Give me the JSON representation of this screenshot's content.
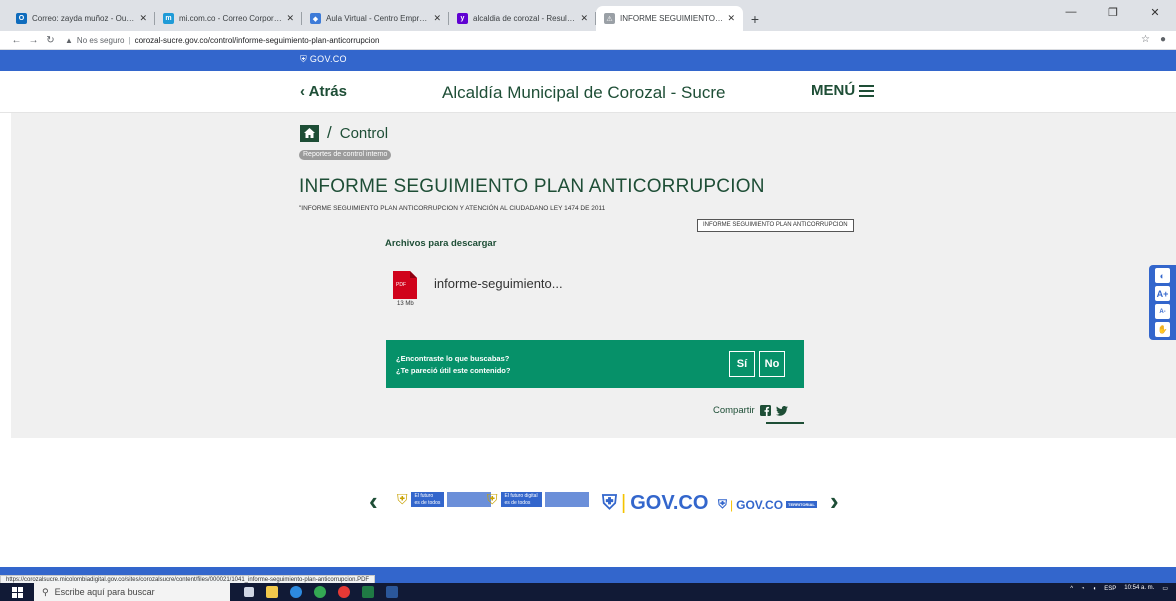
{
  "browser": {
    "tabs": [
      {
        "label": "Correo: zayda muñoz - Outlook",
        "icon": "outlook-icon",
        "color": "#0f6cbd",
        "glyph": "O"
      },
      {
        "label": "mi.com.co - Correo Corporativo",
        "icon": "mail-icon",
        "color": "#1f9bd7",
        "glyph": "m"
      },
      {
        "label": "Aula Virtual - Centro Empresarial",
        "icon": "moodle-icon",
        "color": "#3d7bd8",
        "glyph": "◆"
      },
      {
        "label": "alcaldia de corozal - Resultados",
        "icon": "yahoo-icon",
        "color": "#6001d2",
        "glyph": "y"
      },
      {
        "label": "INFORME SEGUIMIENTO PLAN A",
        "icon": "page-icon",
        "color": "#9aa0a6",
        "glyph": "⚠"
      }
    ],
    "new_tab": "+",
    "not_secure": "No es seguro",
    "url": "corozal-sucre.gov.co/control/informe-seguimiento-plan-anticorrupcion",
    "status_url": "https://corozalsucre.micolombiadigital.gov.co/sites/corozalsucre/content/files/000021/1041_informe-seguimiento-plan-anticorrupcion.PDF"
  },
  "gov": {
    "logo": "GOV.CO"
  },
  "header": {
    "back": "Atrás",
    "title": "Alcaldía Municipal de Corozal - Sucre",
    "menu": "MENÚ"
  },
  "breadcrumb": {
    "separator": "/",
    "label": "Control"
  },
  "tag": "Reportes de control interno",
  "page": {
    "title": "INFORME SEGUIMIENTO PLAN ANTICORRUPCION",
    "subtitle": "\"INFORME SEGUIMIENTO PLAN ANTICORRUPCION Y ATENCIÓN AL CIUDADANO LEY 1474 DE 2011",
    "doc_box": "INFORME SEGUIMIENTO PLAN ANTICORRUPCION"
  },
  "downloads": {
    "heading": "Archivos para descargar",
    "file": {
      "name": "informe-seguimiento...",
      "type": "PDF",
      "size": "13 Mb"
    }
  },
  "feedback": {
    "question1": "¿Encontraste lo que buscabas?",
    "question2": "¿Te pareció útil este contenido?",
    "yes": "Sí",
    "no": "No"
  },
  "share": {
    "label": "Compartir"
  },
  "accessibility": {
    "contrast": "◐",
    "increase": "A+",
    "decrease": "A-",
    "sign": "✋"
  },
  "footer": {
    "logo1_line1": "El futuro",
    "logo1_line2": "es de todos",
    "logo2_line1": "El futuro digital",
    "logo2_line2": "es de todos",
    "gov_big": "GOV.CO",
    "gov_small": "GOV.CO",
    "territorial": "TERRITORIAL"
  },
  "taskbar": {
    "search_placeholder": "Escribe aquí para buscar",
    "lang": "ESP",
    "time": "10:54 a. m."
  },
  "colors": {
    "primary_green": "#1e4e36",
    "feedback_green": "#069169",
    "gov_blue": "#3366cc"
  }
}
